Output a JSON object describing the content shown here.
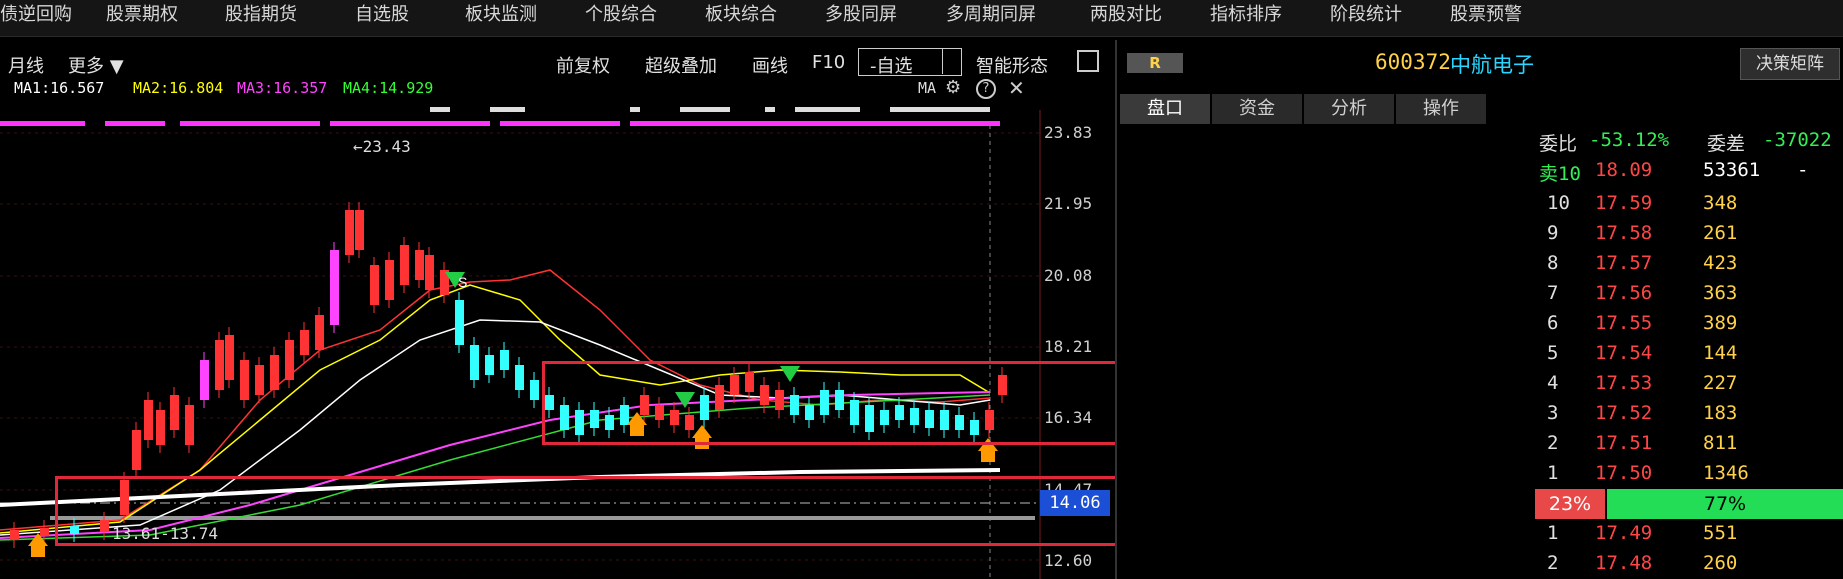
{
  "top_nav": [
    "债逆回购",
    "股票期权",
    "股指期货",
    "自选股",
    "板块监测",
    "个股综合",
    "板块综合",
    "多股同屏",
    "多周期同屏",
    "两股对比",
    "指标排序",
    "阶段统计",
    "股票预警"
  ],
  "toolbar": {
    "period": "月线",
    "more": "更多 ▼",
    "adjust": "前复权",
    "overlay": "超级叠加",
    "draw": "画线",
    "f10": "F10",
    "self_select": "-自选",
    "smart_pattern": "智能形态"
  },
  "ma_legend": {
    "ma1": "MA1:16.567",
    "ma2": "MA2:16.804",
    "ma3": "MA3:16.357",
    "ma4": "MA4:14.929",
    "indicator": "MA",
    "colors": {
      "ma1": "#ffffff",
      "ma2": "#ffff00",
      "ma3": "#ff44ff",
      "ma4": "#33ff33"
    }
  },
  "price_axis": [
    "23.83",
    "21.95",
    "20.08",
    "18.21",
    "16.34",
    "14.47",
    "12.60"
  ],
  "current_price_tag": "14.06",
  "annotations": {
    "high": "←23.43",
    "range": "13.61-13.74",
    "buy_marker": "B",
    "sell_marker": "S"
  },
  "stock": {
    "badge": "R",
    "code": "600372",
    "name": "中航电子",
    "decision_button": "决策矩阵"
  },
  "tabs": [
    "盘口",
    "资金",
    "分析",
    "操作"
  ],
  "orderbook": {
    "weibi_label": "委比",
    "weibi_value": "-53.12%",
    "weicha_label": "委差",
    "weicha_value": "-37022",
    "sell10": {
      "label": "卖10",
      "price": "18.09",
      "vol": "53361",
      "extra": "-"
    },
    "asks": [
      {
        "level": "10",
        "price": "17.59",
        "vol": "348"
      },
      {
        "level": "9",
        "price": "17.58",
        "vol": "261"
      },
      {
        "level": "8",
        "price": "17.57",
        "vol": "423"
      },
      {
        "level": "7",
        "price": "17.56",
        "vol": "363"
      },
      {
        "level": "6",
        "price": "17.55",
        "vol": "389"
      },
      {
        "level": "5",
        "price": "17.54",
        "vol": "144"
      },
      {
        "level": "4",
        "price": "17.53",
        "vol": "227"
      },
      {
        "level": "3",
        "price": "17.52",
        "vol": "183"
      },
      {
        "level": "2",
        "price": "17.51",
        "vol": "811"
      },
      {
        "level": "1",
        "price": "17.50",
        "vol": "1346"
      }
    ],
    "ratio_sell": "23%",
    "ratio_buy": "77%",
    "bids": [
      {
        "level": "1",
        "price": "17.49",
        "vol": "551"
      },
      {
        "level": "2",
        "price": "17.48",
        "vol": "260"
      }
    ]
  }
}
